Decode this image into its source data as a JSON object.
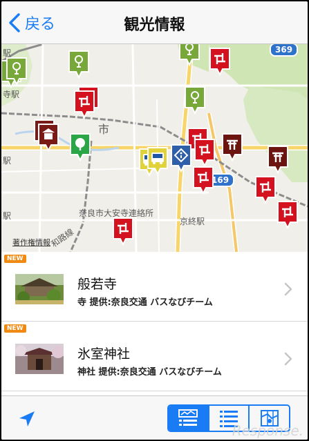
{
  "navbar": {
    "back_label": "戻る",
    "title": "観光情報"
  },
  "map": {
    "labels": {
      "station_top_left": "駅",
      "station_ji": "寺駅",
      "station_eki": "駅",
      "station_eki_bottom": "駅",
      "city": "奈良市大安寺連絡所",
      "kyobate": "京終駅",
      "shi": "市",
      "road": "和路線"
    },
    "routes": [
      "369",
      "169"
    ],
    "attribution": "著作権情報"
  },
  "list": {
    "items": [
      {
        "badge": "NEW",
        "title": "般若寺",
        "subtitle": "寺 提供:奈良交通 バスなびチーム"
      },
      {
        "badge": "NEW",
        "title": "氷室神社",
        "subtitle": "神社 提供:奈良交通 バスなびチーム"
      }
    ]
  },
  "toolbar": {
    "icons": [
      "location-arrow-icon",
      "map-list-icon",
      "list-icon",
      "map-icon"
    ]
  },
  "watermark": "Response.",
  "colors": {
    "accent": "#1a7cf5",
    "temple_red": "#d4121f",
    "shrine_brown": "#6b1410",
    "park_green": "#78a83a",
    "badge_orange": "#f08a12"
  }
}
